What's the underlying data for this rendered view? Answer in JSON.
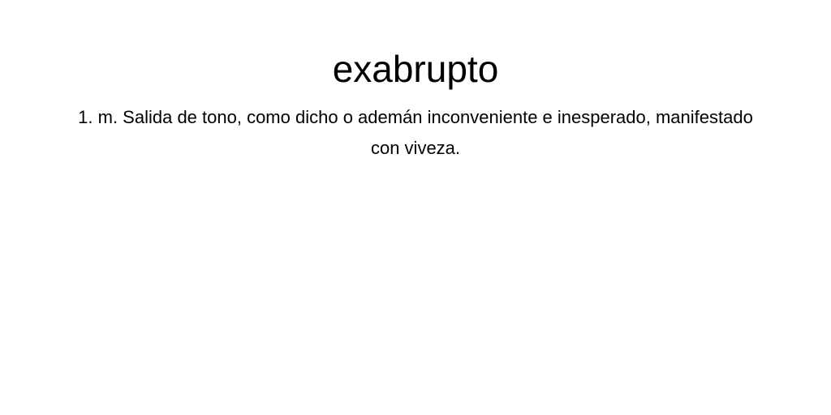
{
  "entry": {
    "term": "exabrupto",
    "definition": "1. m. Salida de tono, como dicho o ademán inconveniente e inesperado, manifestado con viveza."
  }
}
